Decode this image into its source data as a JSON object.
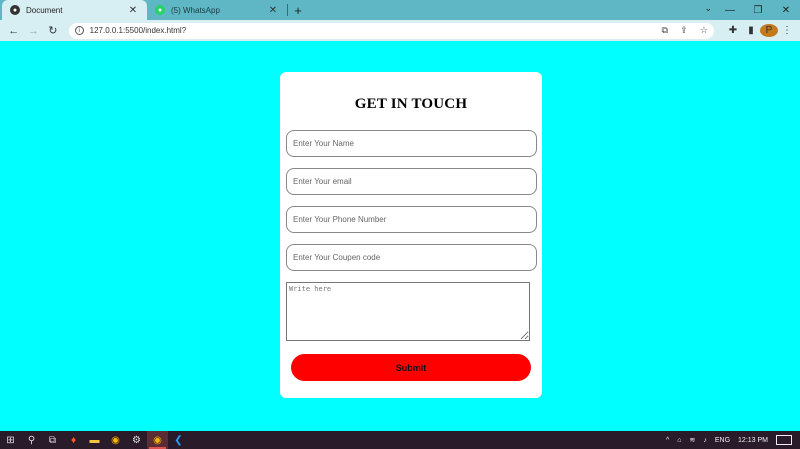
{
  "browser": {
    "tabs": [
      {
        "title": "Document",
        "icon": "document-favicon-icon",
        "active": true
      },
      {
        "title": "(5) WhatsApp",
        "icon": "whatsapp-favicon-icon",
        "active": false
      }
    ],
    "url": "127.0.0.1:5500/index.html?"
  },
  "form": {
    "heading": "GET IN TOUCH",
    "name_placeholder": "Enter Your Name",
    "email_placeholder": "Enter Your email",
    "phone_placeholder": "Enter Your Phone Number",
    "coupon_placeholder": "Enter Your Coupen code",
    "message_placeholder": "Write here",
    "submit_label": "Submit"
  },
  "taskbar": {
    "language": "ENG",
    "time": "12:13 PM"
  },
  "colors": {
    "page_background": "#00ffff",
    "tabstrip": "#5fb7c6",
    "submit_button": "#ff0000",
    "taskbar": "#2a1b2a"
  }
}
